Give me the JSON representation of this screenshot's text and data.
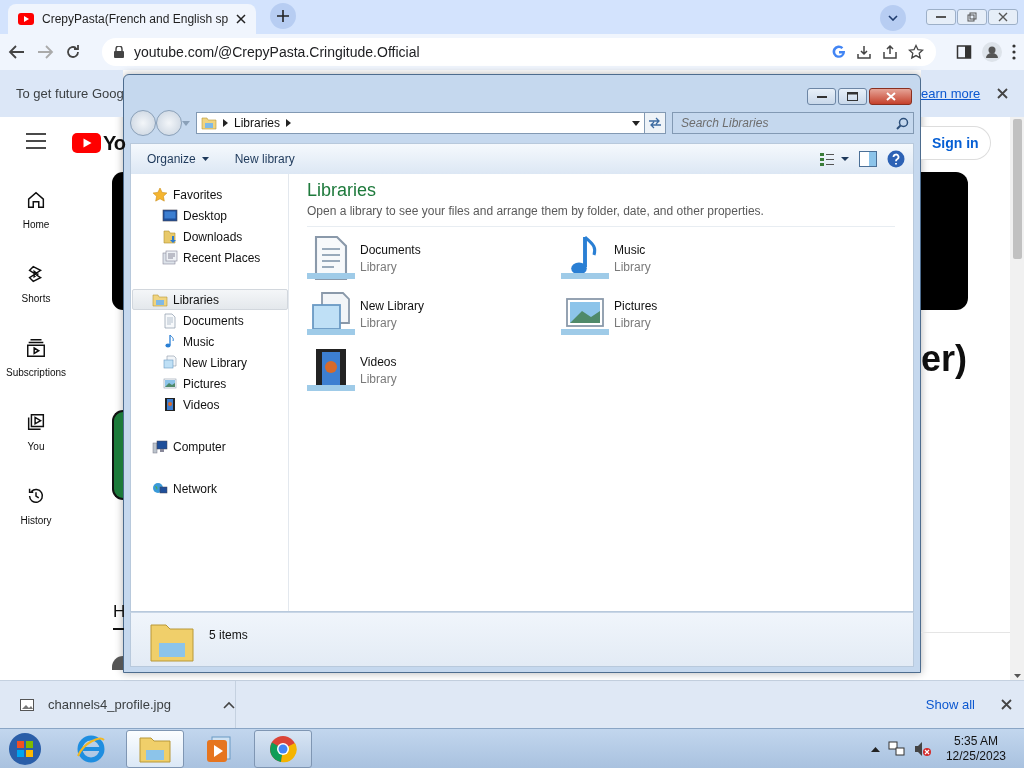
{
  "browser": {
    "tab": {
      "title": "CrepyPasta(French and English sp"
    },
    "address": "youtube.com/@CrepyPasta.Cringitude.Official",
    "infobar": {
      "text": "To get future Goog",
      "link": "earn more"
    }
  },
  "youtube": {
    "logo_text": "Yo",
    "rail": [
      {
        "kind": "home",
        "label": "Home"
      },
      {
        "kind": "shorts",
        "label": "Shorts"
      },
      {
        "kind": "subscriptions",
        "label": "Subscriptions"
      },
      {
        "kind": "you",
        "label": "You"
      },
      {
        "kind": "history",
        "label": "History"
      }
    ],
    "sign_in": "Sign in",
    "title_fragment": "er)",
    "tab_fragment": "H"
  },
  "explorer": {
    "breadcrumb": "Libraries",
    "search_placeholder": "Search Libraries",
    "toolbar": [
      "Organize",
      "New library"
    ],
    "nav": [
      {
        "kind": "favorites",
        "label": "Favorites",
        "selected": false,
        "children": [
          {
            "kind": "desktop",
            "label": "Desktop",
            "selected": false
          },
          {
            "kind": "downloads",
            "label": "Downloads",
            "selected": false
          },
          {
            "kind": "recent",
            "label": "Recent Places",
            "selected": false
          }
        ]
      },
      {
        "kind": "libraries",
        "label": "Libraries",
        "selected": true,
        "children": [
          {
            "kind": "documents",
            "label": "Documents",
            "selected": false
          },
          {
            "kind": "music",
            "label": "Music",
            "selected": false
          },
          {
            "kind": "library",
            "label": "New Library",
            "selected": false
          },
          {
            "kind": "pictures",
            "label": "Pictures",
            "selected": false
          },
          {
            "kind": "videos",
            "label": "Videos",
            "selected": false
          }
        ]
      },
      {
        "kind": "computer",
        "label": "Computer",
        "selected": false
      },
      {
        "kind": "network",
        "label": "Network",
        "selected": false
      }
    ],
    "heading": "Libraries",
    "description": "Open a library to see your files and arrange them by folder, date, and other properties.",
    "items": [
      {
        "kind": "documents",
        "name": "Documents",
        "type": "Library"
      },
      {
        "kind": "music",
        "name": "Music",
        "type": "Library"
      },
      {
        "kind": "library",
        "name": "New Library",
        "type": "Library"
      },
      {
        "kind": "pictures",
        "name": "Pictures",
        "type": "Library"
      },
      {
        "kind": "videos",
        "name": "Videos",
        "type": "Library"
      }
    ],
    "status": "5 items"
  },
  "downloads": {
    "file": "channels4_profile.jpg",
    "show_all": "Show all"
  },
  "taskbar": {
    "apps": [
      {
        "kind": "ie",
        "running": false,
        "selected": false
      },
      {
        "kind": "explorer",
        "running": true,
        "selected": true
      },
      {
        "kind": "media",
        "running": false,
        "selected": false
      },
      {
        "kind": "chrome",
        "running": true,
        "selected": false
      }
    ],
    "time": "5:35 AM",
    "date": "12/25/2023"
  }
}
